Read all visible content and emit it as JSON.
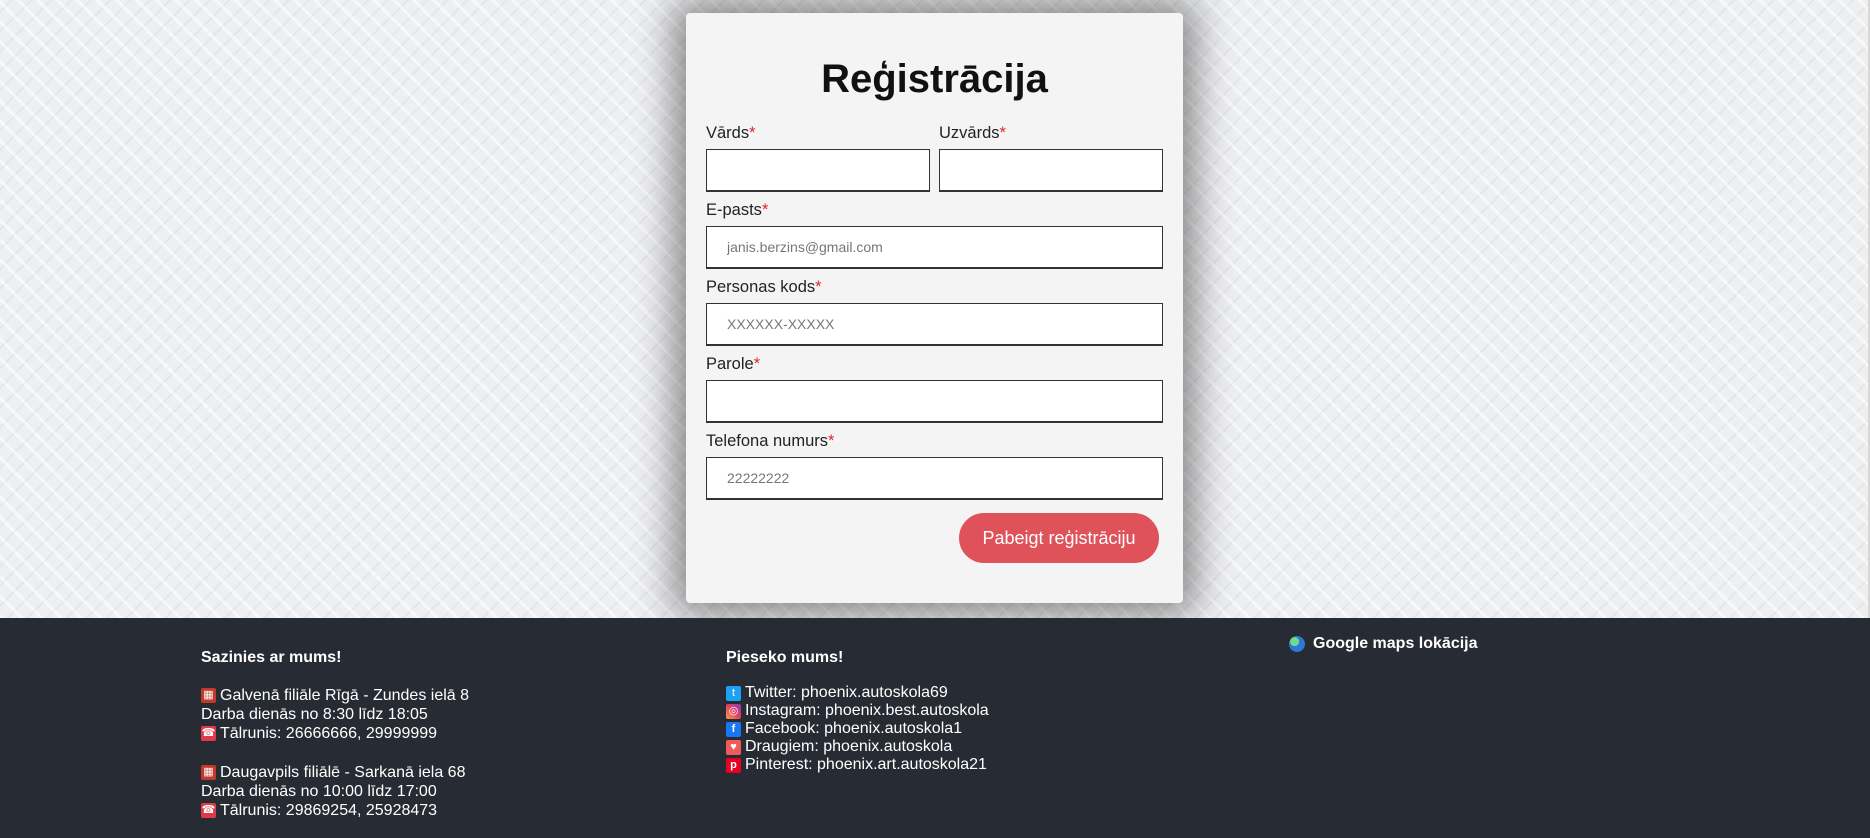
{
  "form": {
    "title": "Reģistrācija",
    "required_marker": "*",
    "fields": {
      "first_name": {
        "label": "Vārds",
        "placeholder": ""
      },
      "last_name": {
        "label": "Uzvārds",
        "placeholder": ""
      },
      "email": {
        "label": "E-pasts",
        "placeholder": "janis.berzins@gmail.com"
      },
      "personal_code": {
        "label": "Personas kods",
        "placeholder": "XXXXXX-XXXXX"
      },
      "password": {
        "label": "Parole",
        "placeholder": ""
      },
      "phone": {
        "label": "Telefona numurs",
        "placeholder": "22222222"
      }
    },
    "submit_label": "Pabeigt reģistrāciju"
  },
  "footer": {
    "contact": {
      "title": "Sazinies ar mums!",
      "branches": [
        {
          "address": "Galvenā filiāle Rīgā - Zundes ielā 8",
          "hours": "Darba dienās no 8:30 līdz 18:05",
          "phone": "Tālrunis: 26666666, 29999999"
        },
        {
          "address": "Daugavpils filiālē - Sarkanā iela 68",
          "hours": "Darba dienās no 10:00 līdz 17:00",
          "phone": "Tālrunis: 29869254, 25928473"
        }
      ]
    },
    "social": {
      "title": "Pieseko mums!",
      "items": [
        {
          "icon": "twitter-icon",
          "label": "Twitter: phoenix.autoskola69",
          "color": "#1da1f2"
        },
        {
          "icon": "instagram-icon",
          "label": "Instagram: phoenix.best.autoskola",
          "color": "#e4405f"
        },
        {
          "icon": "facebook-icon",
          "label": "Facebook: phoenix.autoskola1",
          "color": "#1877f2"
        },
        {
          "icon": "draugiem-icon",
          "label": "Draugiem: phoenix.autoskola",
          "color": "#f15a5a"
        },
        {
          "icon": "pinterest-icon",
          "label": "Pinterest: phoenix.art.autoskola21",
          "color": "#e60023"
        }
      ]
    },
    "maps": {
      "label": "Google maps lokācija"
    }
  },
  "colors": {
    "accent": "#e0525a",
    "footer_bg": "#272b33",
    "required": "#e0262b"
  }
}
